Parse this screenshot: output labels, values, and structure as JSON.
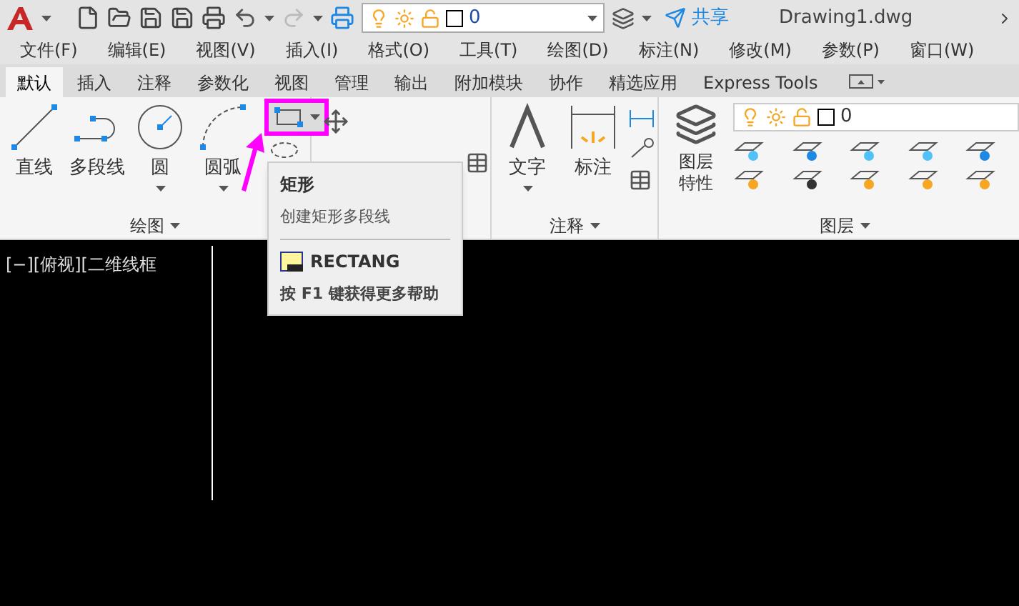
{
  "quick_access": {
    "layer_value": "0",
    "share": "共享",
    "file_name": "Drawing1.dwg"
  },
  "menu": [
    "文件(F)",
    "编辑(E)",
    "视图(V)",
    "插入(I)",
    "格式(O)",
    "工具(T)",
    "绘图(D)",
    "标注(N)",
    "修改(M)",
    "参数(P)",
    "窗口(W)"
  ],
  "ribbon_tabs": [
    {
      "label": "默认",
      "selected": true
    },
    {
      "label": "插入",
      "selected": false
    },
    {
      "label": "注释",
      "selected": false
    },
    {
      "label": "参数化",
      "selected": false
    },
    {
      "label": "视图",
      "selected": false
    },
    {
      "label": "管理",
      "selected": false
    },
    {
      "label": "输出",
      "selected": false
    },
    {
      "label": "附加模块",
      "selected": false
    },
    {
      "label": "协作",
      "selected": false
    },
    {
      "label": "精选应用",
      "selected": false
    },
    {
      "label": "Express Tools",
      "selected": false
    }
  ],
  "draw_panel": {
    "title": "绘图",
    "tools": [
      {
        "kind": "line",
        "label": "直线",
        "dropdown": false
      },
      {
        "kind": "polyline",
        "label": "多段线",
        "dropdown": false
      },
      {
        "kind": "circle",
        "label": "圆",
        "dropdown": true
      },
      {
        "kind": "arc",
        "label": "圆弧",
        "dropdown": true
      }
    ],
    "rectangle_highlighted": true
  },
  "annotation_panel": {
    "title": "注释",
    "tools": [
      {
        "kind": "text",
        "label": "文字",
        "dropdown": true
      },
      {
        "kind": "dimension",
        "label": "标注",
        "dropdown": false
      }
    ]
  },
  "layers_panel": {
    "title": "图层",
    "properties_label": "图层特性",
    "layer_value": "0"
  },
  "tooltip": {
    "title": "矩形",
    "description": "创建矩形多段线",
    "command": "RECTANG",
    "help": "按 F1 键获得更多帮助"
  },
  "viewport": {
    "label": "[−][俯视][二维线框"
  }
}
